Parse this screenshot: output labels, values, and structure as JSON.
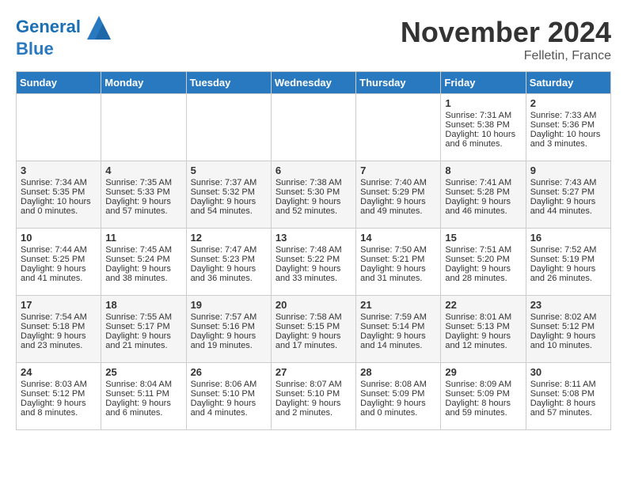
{
  "header": {
    "logo_line1": "General",
    "logo_line2": "Blue",
    "month_title": "November 2024",
    "location": "Felletin, France"
  },
  "weekdays": [
    "Sunday",
    "Monday",
    "Tuesday",
    "Wednesday",
    "Thursday",
    "Friday",
    "Saturday"
  ],
  "weeks": [
    [
      {
        "day": "",
        "info": ""
      },
      {
        "day": "",
        "info": ""
      },
      {
        "day": "",
        "info": ""
      },
      {
        "day": "",
        "info": ""
      },
      {
        "day": "",
        "info": ""
      },
      {
        "day": "1",
        "info": "Sunrise: 7:31 AM\nSunset: 5:38 PM\nDaylight: 10 hours\nand 6 minutes."
      },
      {
        "day": "2",
        "info": "Sunrise: 7:33 AM\nSunset: 5:36 PM\nDaylight: 10 hours\nand 3 minutes."
      }
    ],
    [
      {
        "day": "3",
        "info": "Sunrise: 7:34 AM\nSunset: 5:35 PM\nDaylight: 10 hours\nand 0 minutes."
      },
      {
        "day": "4",
        "info": "Sunrise: 7:35 AM\nSunset: 5:33 PM\nDaylight: 9 hours\nand 57 minutes."
      },
      {
        "day": "5",
        "info": "Sunrise: 7:37 AM\nSunset: 5:32 PM\nDaylight: 9 hours\nand 54 minutes."
      },
      {
        "day": "6",
        "info": "Sunrise: 7:38 AM\nSunset: 5:30 PM\nDaylight: 9 hours\nand 52 minutes."
      },
      {
        "day": "7",
        "info": "Sunrise: 7:40 AM\nSunset: 5:29 PM\nDaylight: 9 hours\nand 49 minutes."
      },
      {
        "day": "8",
        "info": "Sunrise: 7:41 AM\nSunset: 5:28 PM\nDaylight: 9 hours\nand 46 minutes."
      },
      {
        "day": "9",
        "info": "Sunrise: 7:43 AM\nSunset: 5:27 PM\nDaylight: 9 hours\nand 44 minutes."
      }
    ],
    [
      {
        "day": "10",
        "info": "Sunrise: 7:44 AM\nSunset: 5:25 PM\nDaylight: 9 hours\nand 41 minutes."
      },
      {
        "day": "11",
        "info": "Sunrise: 7:45 AM\nSunset: 5:24 PM\nDaylight: 9 hours\nand 38 minutes."
      },
      {
        "day": "12",
        "info": "Sunrise: 7:47 AM\nSunset: 5:23 PM\nDaylight: 9 hours\nand 36 minutes."
      },
      {
        "day": "13",
        "info": "Sunrise: 7:48 AM\nSunset: 5:22 PM\nDaylight: 9 hours\nand 33 minutes."
      },
      {
        "day": "14",
        "info": "Sunrise: 7:50 AM\nSunset: 5:21 PM\nDaylight: 9 hours\nand 31 minutes."
      },
      {
        "day": "15",
        "info": "Sunrise: 7:51 AM\nSunset: 5:20 PM\nDaylight: 9 hours\nand 28 minutes."
      },
      {
        "day": "16",
        "info": "Sunrise: 7:52 AM\nSunset: 5:19 PM\nDaylight: 9 hours\nand 26 minutes."
      }
    ],
    [
      {
        "day": "17",
        "info": "Sunrise: 7:54 AM\nSunset: 5:18 PM\nDaylight: 9 hours\nand 23 minutes."
      },
      {
        "day": "18",
        "info": "Sunrise: 7:55 AM\nSunset: 5:17 PM\nDaylight: 9 hours\nand 21 minutes."
      },
      {
        "day": "19",
        "info": "Sunrise: 7:57 AM\nSunset: 5:16 PM\nDaylight: 9 hours\nand 19 minutes."
      },
      {
        "day": "20",
        "info": "Sunrise: 7:58 AM\nSunset: 5:15 PM\nDaylight: 9 hours\nand 17 minutes."
      },
      {
        "day": "21",
        "info": "Sunrise: 7:59 AM\nSunset: 5:14 PM\nDaylight: 9 hours\nand 14 minutes."
      },
      {
        "day": "22",
        "info": "Sunrise: 8:01 AM\nSunset: 5:13 PM\nDaylight: 9 hours\nand 12 minutes."
      },
      {
        "day": "23",
        "info": "Sunrise: 8:02 AM\nSunset: 5:12 PM\nDaylight: 9 hours\nand 10 minutes."
      }
    ],
    [
      {
        "day": "24",
        "info": "Sunrise: 8:03 AM\nSunset: 5:12 PM\nDaylight: 9 hours\nand 8 minutes."
      },
      {
        "day": "25",
        "info": "Sunrise: 8:04 AM\nSunset: 5:11 PM\nDaylight: 9 hours\nand 6 minutes."
      },
      {
        "day": "26",
        "info": "Sunrise: 8:06 AM\nSunset: 5:10 PM\nDaylight: 9 hours\nand 4 minutes."
      },
      {
        "day": "27",
        "info": "Sunrise: 8:07 AM\nSunset: 5:10 PM\nDaylight: 9 hours\nand 2 minutes."
      },
      {
        "day": "28",
        "info": "Sunrise: 8:08 AM\nSunset: 5:09 PM\nDaylight: 9 hours\nand 0 minutes."
      },
      {
        "day": "29",
        "info": "Sunrise: 8:09 AM\nSunset: 5:09 PM\nDaylight: 8 hours\nand 59 minutes."
      },
      {
        "day": "30",
        "info": "Sunrise: 8:11 AM\nSunset: 5:08 PM\nDaylight: 8 hours\nand 57 minutes."
      }
    ]
  ]
}
